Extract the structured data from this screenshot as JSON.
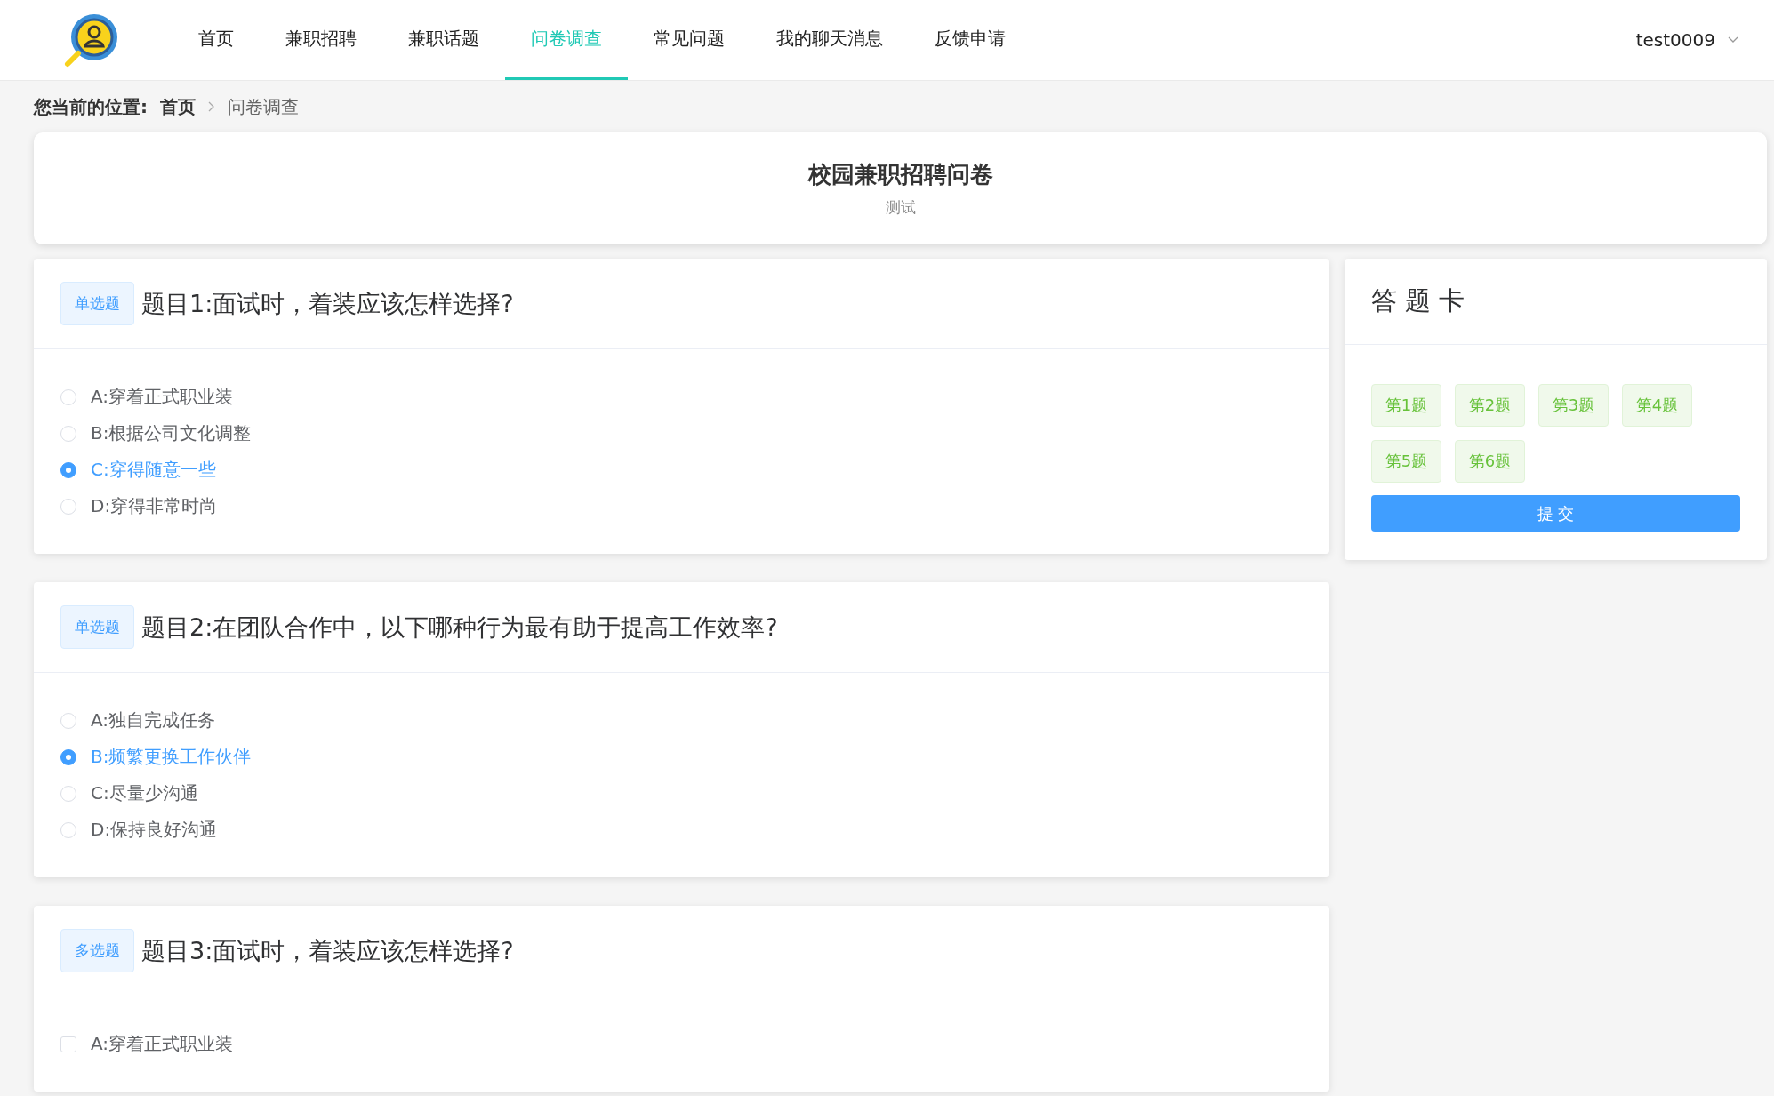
{
  "nav": {
    "items": [
      {
        "label": "首页",
        "selected": false
      },
      {
        "label": "兼职招聘",
        "selected": false
      },
      {
        "label": "兼职话题",
        "selected": false
      },
      {
        "label": "问卷调查",
        "selected": true
      },
      {
        "label": "常见问题",
        "selected": false
      },
      {
        "label": "我的聊天消息",
        "selected": false
      },
      {
        "label": "反馈申请",
        "selected": false
      }
    ],
    "user": "test0009"
  },
  "breadcrumb": {
    "label": "您当前的位置:",
    "items": [
      "首页",
      "问卷调查"
    ]
  },
  "survey": {
    "title": "校园兼职招聘问卷",
    "subtitle": "测试"
  },
  "questions": [
    {
      "kind": "single",
      "tag": "单选题",
      "title": "题目1:面试时，着装应该怎样选择?",
      "options": [
        {
          "label": "A:穿着正式职业装",
          "selected": false
        },
        {
          "label": "B:根据公司文化调整",
          "selected": false
        },
        {
          "label": "C:穿得随意一些",
          "selected": true
        },
        {
          "label": "D:穿得非常时尚",
          "selected": false
        }
      ]
    },
    {
      "kind": "single",
      "tag": "单选题",
      "title": "题目2:在团队合作中，以下哪种行为最有助于提高工作效率?",
      "options": [
        {
          "label": "A:独自完成任务",
          "selected": false
        },
        {
          "label": "B:频繁更换工作伙伴",
          "selected": true
        },
        {
          "label": "C:尽量少沟通",
          "selected": false
        },
        {
          "label": "D:保持良好沟通",
          "selected": false
        }
      ]
    },
    {
      "kind": "multi",
      "tag": "多选题",
      "title": "题目3:面试时，着装应该怎样选择?",
      "options": [
        {
          "label": "A:穿着正式职业装",
          "selected": false
        }
      ]
    }
  ],
  "answer_card": {
    "title": "答 题 卡",
    "items": [
      "第1题",
      "第2题",
      "第3题",
      "第4题",
      "第5题",
      "第6题"
    ],
    "submit": "提 交"
  }
}
